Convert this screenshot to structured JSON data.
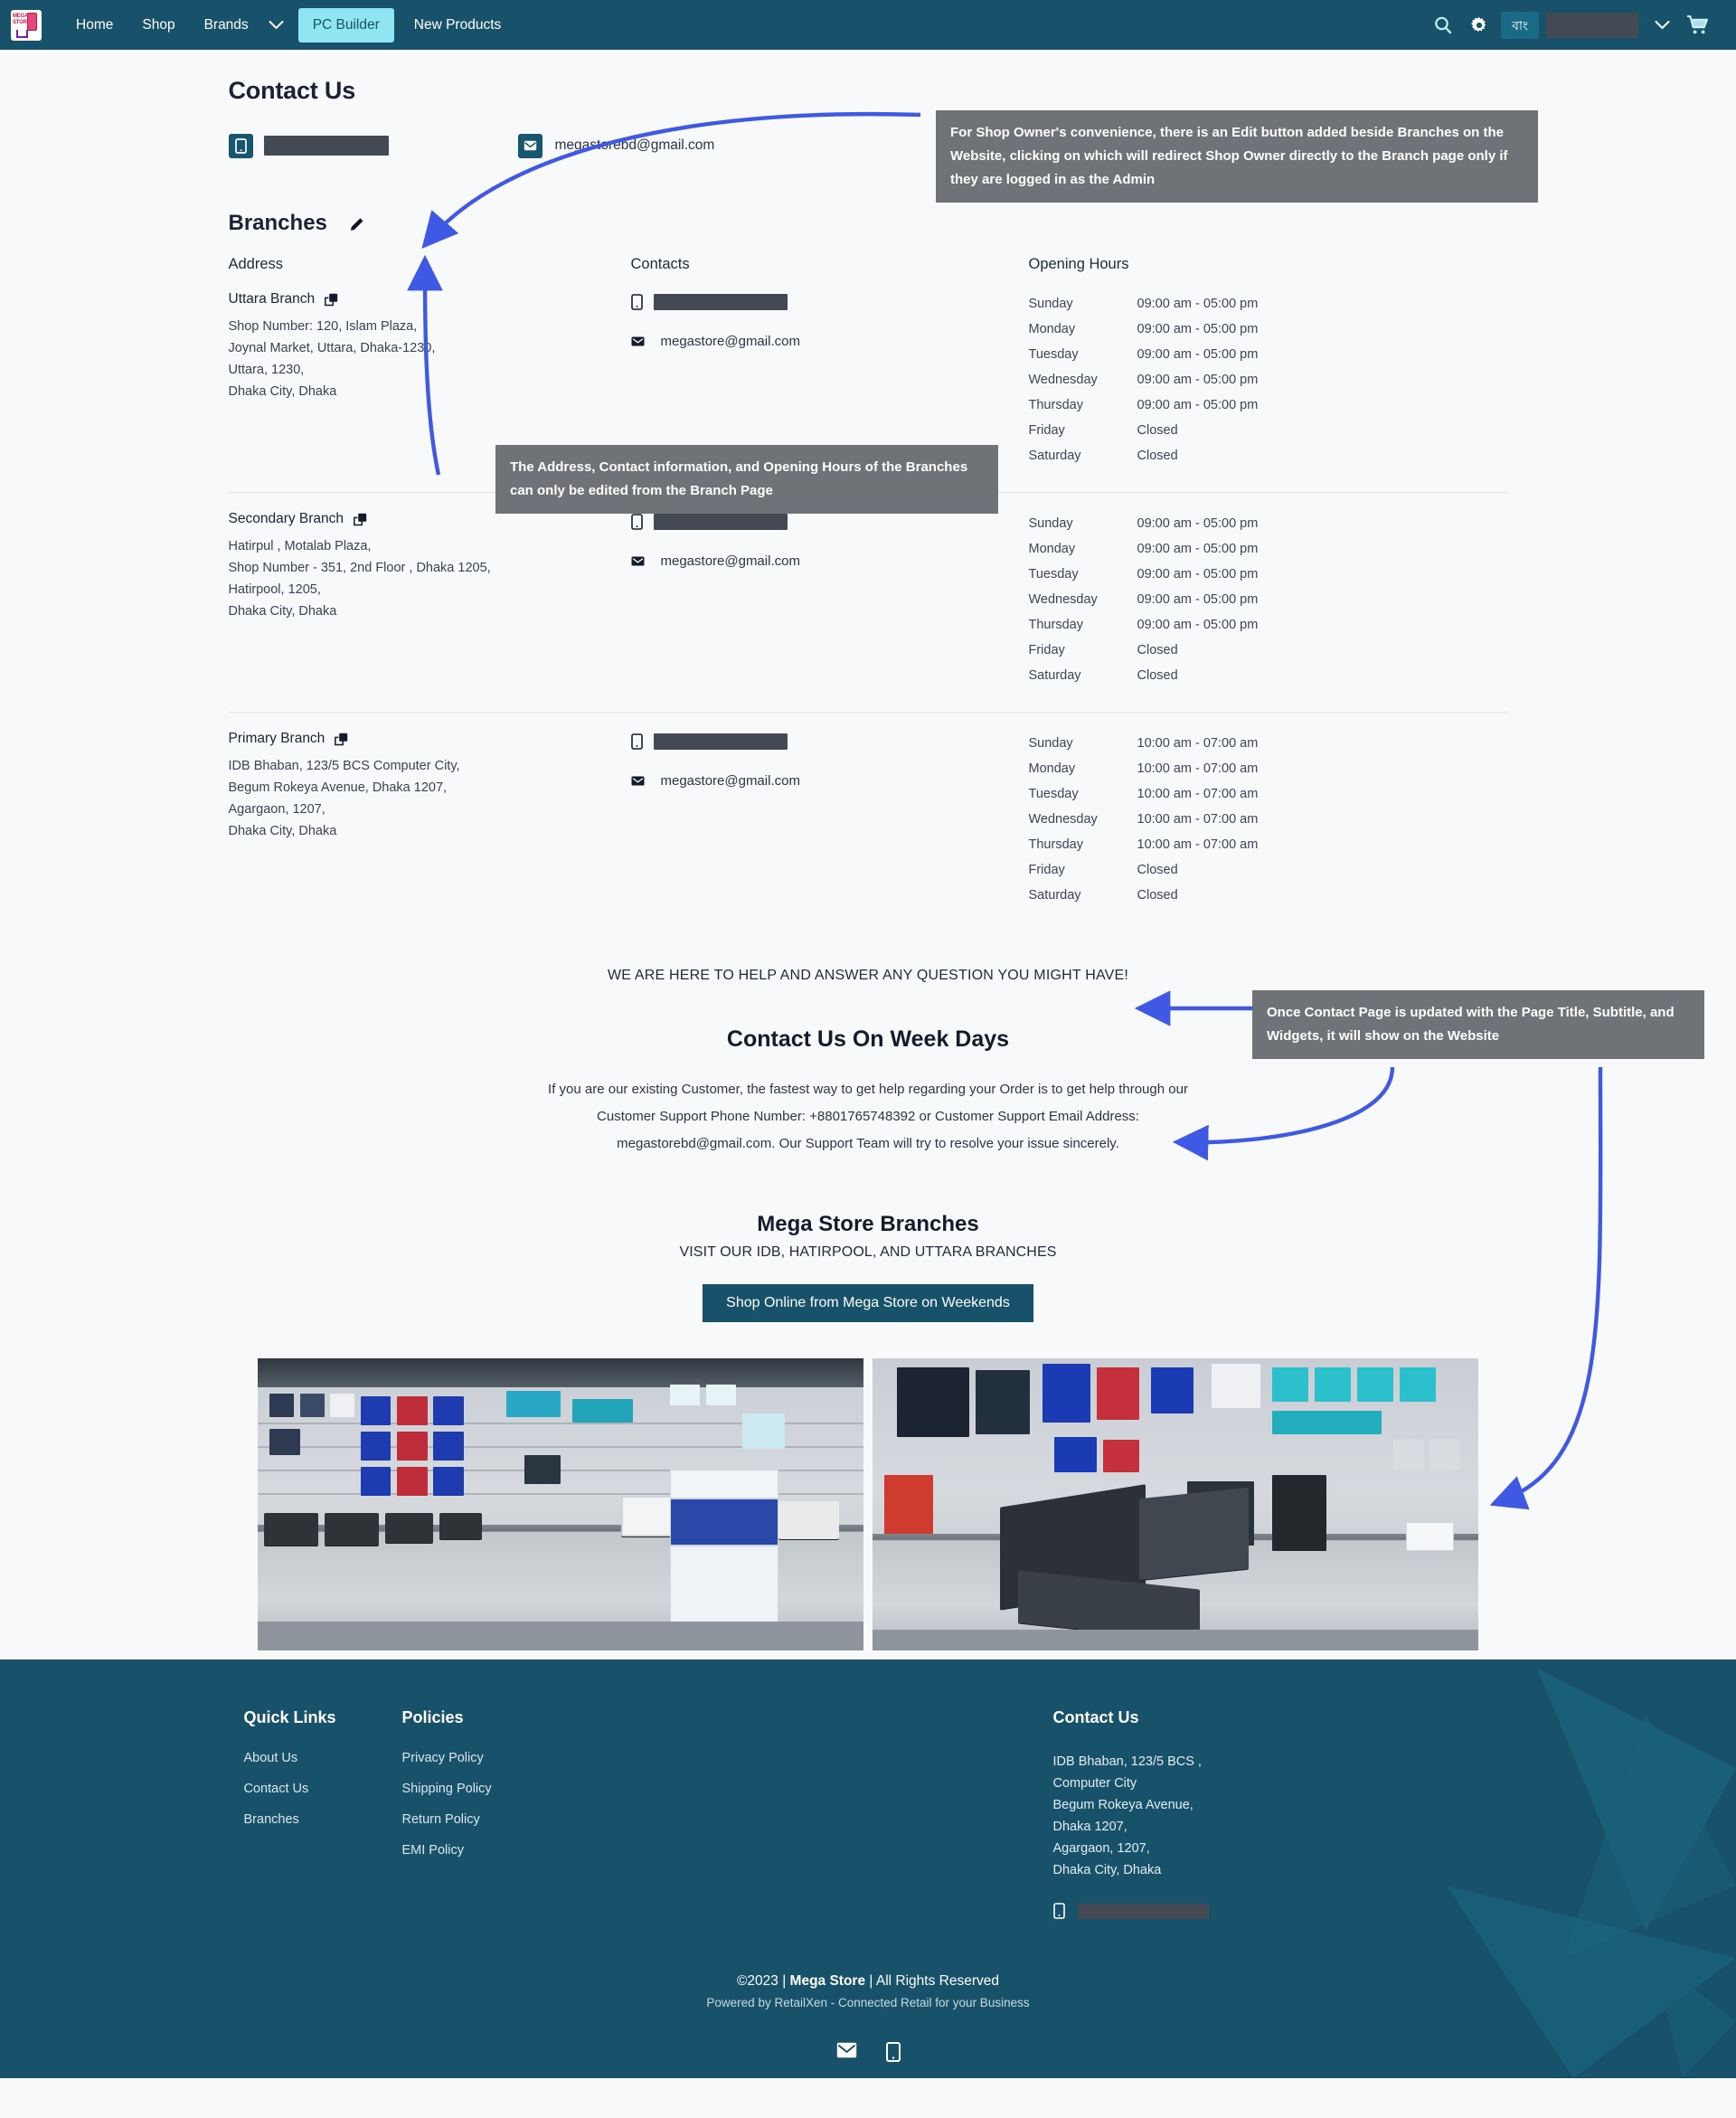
{
  "navbar": {
    "logo_alt": "Mega Store",
    "logo_line1": "MEGA",
    "logo_line2": "STORE",
    "links": [
      {
        "label": "Home",
        "active": false
      },
      {
        "label": "Shop",
        "active": false
      },
      {
        "label": "Brands",
        "active": false
      },
      {
        "label": "PC Builder",
        "active": true
      },
      {
        "label": "New Products",
        "active": false
      }
    ],
    "language_label": "বাং",
    "account_redacted": "",
    "icons": [
      "search-icon",
      "gear-icon",
      "chevron-down-icon",
      "cart-icon"
    ]
  },
  "page": {
    "title": "Contact Us",
    "top_contacts": {
      "phone_redacted": "",
      "email": "megastorebd@gmail.com"
    },
    "branches_heading": "Branches",
    "columns": {
      "address": "Address",
      "contacts": "Contacts",
      "hours": "Opening Hours"
    },
    "branches": [
      {
        "name": "Uttara Branch",
        "address_lines": [
          "Shop Number: 120, Islam Plaza,",
          "Joynal Market, Uttara, Dhaka-1230,",
          "Uttara, 1230,",
          "Dhaka City, Dhaka"
        ],
        "phone_redacted": "",
        "email": "megastore@gmail.com",
        "hours": [
          {
            "day": "Sunday",
            "time": "09:00 am - 05:00 pm"
          },
          {
            "day": "Monday",
            "time": "09:00 am - 05:00 pm"
          },
          {
            "day": "Tuesday",
            "time": "09:00 am - 05:00 pm"
          },
          {
            "day": "Wednesday",
            "time": "09:00 am - 05:00 pm"
          },
          {
            "day": "Thursday",
            "time": "09:00 am - 05:00 pm"
          },
          {
            "day": "Friday",
            "time": "Closed"
          },
          {
            "day": "Saturday",
            "time": "Closed"
          }
        ]
      },
      {
        "name": "Secondary Branch",
        "address_lines": [
          "Hatirpul , Motalab Plaza,",
          "Shop Number - 351, 2nd Floor , Dhaka 1205,",
          "Hatirpool, 1205,",
          "Dhaka City, Dhaka"
        ],
        "phone_redacted": "",
        "email": "megastore@gmail.com",
        "hours": [
          {
            "day": "Sunday",
            "time": "09:00 am - 05:00 pm"
          },
          {
            "day": "Monday",
            "time": "09:00 am - 05:00 pm"
          },
          {
            "day": "Tuesday",
            "time": "09:00 am - 05:00 pm"
          },
          {
            "day": "Wednesday",
            "time": "09:00 am - 05:00 pm"
          },
          {
            "day": "Thursday",
            "time": "09:00 am - 05:00 pm"
          },
          {
            "day": "Friday",
            "time": "Closed"
          },
          {
            "day": "Saturday",
            "time": "Closed"
          }
        ]
      },
      {
        "name": "Primary Branch",
        "address_lines": [
          "IDB Bhaban, 123/5 BCS Computer City,",
          "Begum Rokeya Avenue, Dhaka 1207,",
          "Agargaon, 1207,",
          "Dhaka City, Dhaka"
        ],
        "phone_redacted": "",
        "email": "megastore@gmail.com",
        "hours": [
          {
            "day": "Sunday",
            "time": "10:00 am - 07:00 am"
          },
          {
            "day": "Monday",
            "time": "10:00 am - 07:00 am"
          },
          {
            "day": "Tuesday",
            "time": "10:00 am - 07:00 am"
          },
          {
            "day": "Wednesday",
            "time": "10:00 am - 07:00 am"
          },
          {
            "day": "Thursday",
            "time": "10:00 am - 07:00 am"
          },
          {
            "day": "Friday",
            "time": "Closed"
          },
          {
            "day": "Saturday",
            "time": "Closed"
          }
        ]
      }
    ],
    "widgets": {
      "tagline": "WE ARE HERE TO HELP AND ANSWER ANY QUESTION YOU MIGHT HAVE!",
      "section_title": "Contact Us On Week Days",
      "section_body": "If you are our existing Customer, the fastest way to get help regarding your Order is to get help through our Customer Support Phone Number: +8801765748392 or Customer Support Email Address: megastorebd@gmail.com. Our Support Team will try to resolve your issue sincerely.",
      "branches_title": "Mega Store Branches",
      "branches_subtitle": "VISIT OUR IDB, HATIRPOOL, AND UTTARA BRANCHES",
      "cta_button": "Shop Online from Mega Store on Weekends"
    }
  },
  "annotations": [
    {
      "id": "edit-button-note",
      "text": "For Shop Owner's convenience, there is an Edit button added beside Branches on the Website, clicking on which will redirect Shop Owner directly to the Branch page only if they are logged in as the Admin"
    },
    {
      "id": "branch-page-note",
      "text": "The Address, Contact information, and Opening Hours of the Branches can only be edited from the Branch Page"
    },
    {
      "id": "contact-page-note",
      "text": "Once Contact Page is updated with the Page Title, Subtitle, and Widgets, it will show on the Website"
    }
  ],
  "footer": {
    "quick_links": {
      "heading": "Quick Links",
      "items": [
        "About Us",
        "Contact Us",
        "Branches"
      ]
    },
    "policies": {
      "heading": "Policies",
      "items": [
        "Privacy Policy",
        "Shipping Policy",
        "Return Policy",
        "EMI Policy"
      ]
    },
    "contact": {
      "heading": "Contact Us",
      "address_lines": [
        "IDB Bhaban, 123/5 BCS           ,",
        "Computer City",
        "Begum Rokeya Avenue,",
        "Dhaka 1207,",
        "Agargaon, 1207,",
        "Dhaka City, Dhaka"
      ],
      "phone_redacted": ""
    },
    "copyright_pre": "©2023 | ",
    "copyright_brand": "Mega Store",
    "copyright_post": " | All Rights Reserved",
    "powered_by": "Powered by RetailXen - Connected Retail for your Business"
  },
  "colors": {
    "brand": "#17526a",
    "accent": "#8fe6f2",
    "annotation_bg": "#6f7277",
    "arrow": "#3f59e4",
    "page_bg": "#f8f9fb",
    "redaction": "#434a54"
  }
}
